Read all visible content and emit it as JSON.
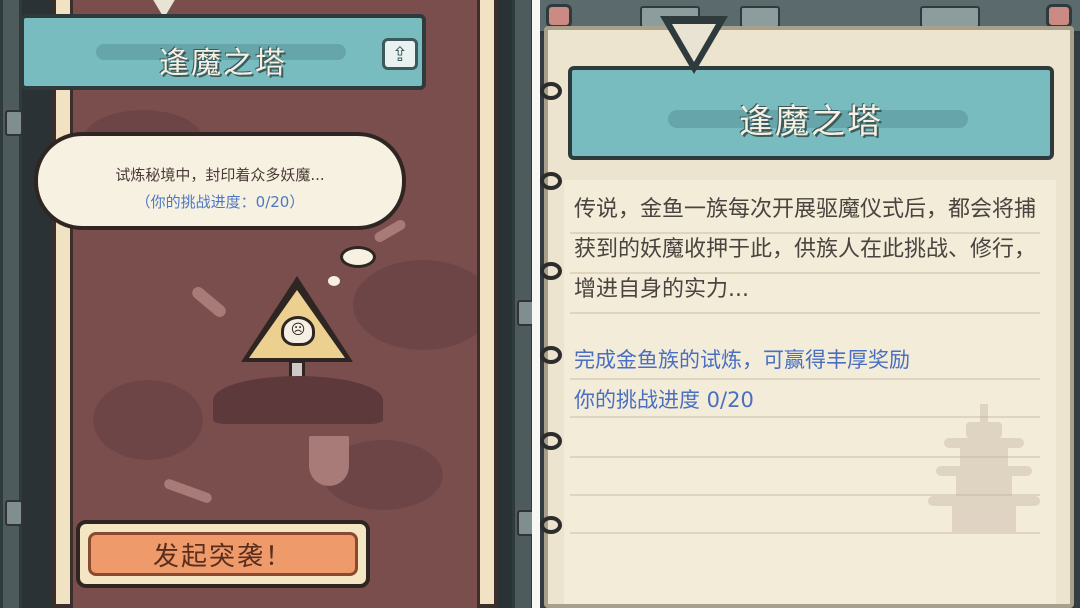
{
  "left": {
    "title": "逢魔之塔",
    "share_icon": "share-icon",
    "speech_line1": "试炼秘境中，封印着众多妖魔...",
    "speech_line2": "（你的挑战进度：0/20）",
    "attack_button": "发起突袭！"
  },
  "right": {
    "title": "逢魔之塔",
    "description": "传说，金鱼一族每次开展驱魔仪式后，都会将捕获到的妖魔收押于此，供族人在此挑战、修行，增进自身的实力...",
    "reward_text": "完成金鱼族的试炼，可赢得丰厚奖励",
    "progress_text": "你的挑战进度  0/20"
  },
  "colors": {
    "title_teal": "#79bcc0",
    "card_maroon": "#7b4e4e",
    "button_orange": "#ef9a6a",
    "accent_blue": "#4a6fc2",
    "paper": "#f2ecd9"
  }
}
